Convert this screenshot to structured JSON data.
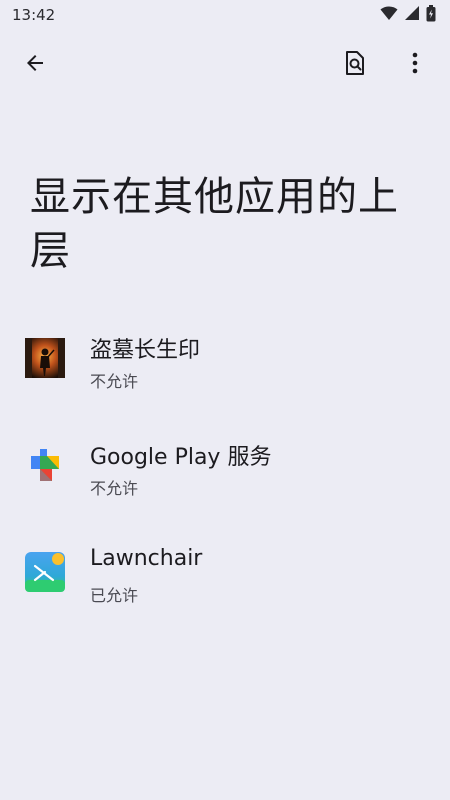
{
  "status_bar": {
    "time": "13:42",
    "icons": [
      "wifi-icon",
      "signal-icon",
      "battery-icon"
    ]
  },
  "toolbar": {
    "back_icon": "arrow-back-icon",
    "search_icon": "search-settings-icon",
    "more_icon": "more-vert-icon"
  },
  "page": {
    "title": "显示在其他应用的上层"
  },
  "apps": [
    {
      "name": "盗墓长生印",
      "status": "不允许",
      "icon": "game-app-icon"
    },
    {
      "name": "Google Play 服务",
      "status": "不允许",
      "icon": "google-play-services-icon"
    },
    {
      "name": "Lawnchair",
      "status": "已允许",
      "icon": "lawnchair-icon"
    }
  ],
  "colors": {
    "background": "#ececf4",
    "text_primary": "#1c1b1f",
    "text_secondary": "#4a4a52"
  }
}
